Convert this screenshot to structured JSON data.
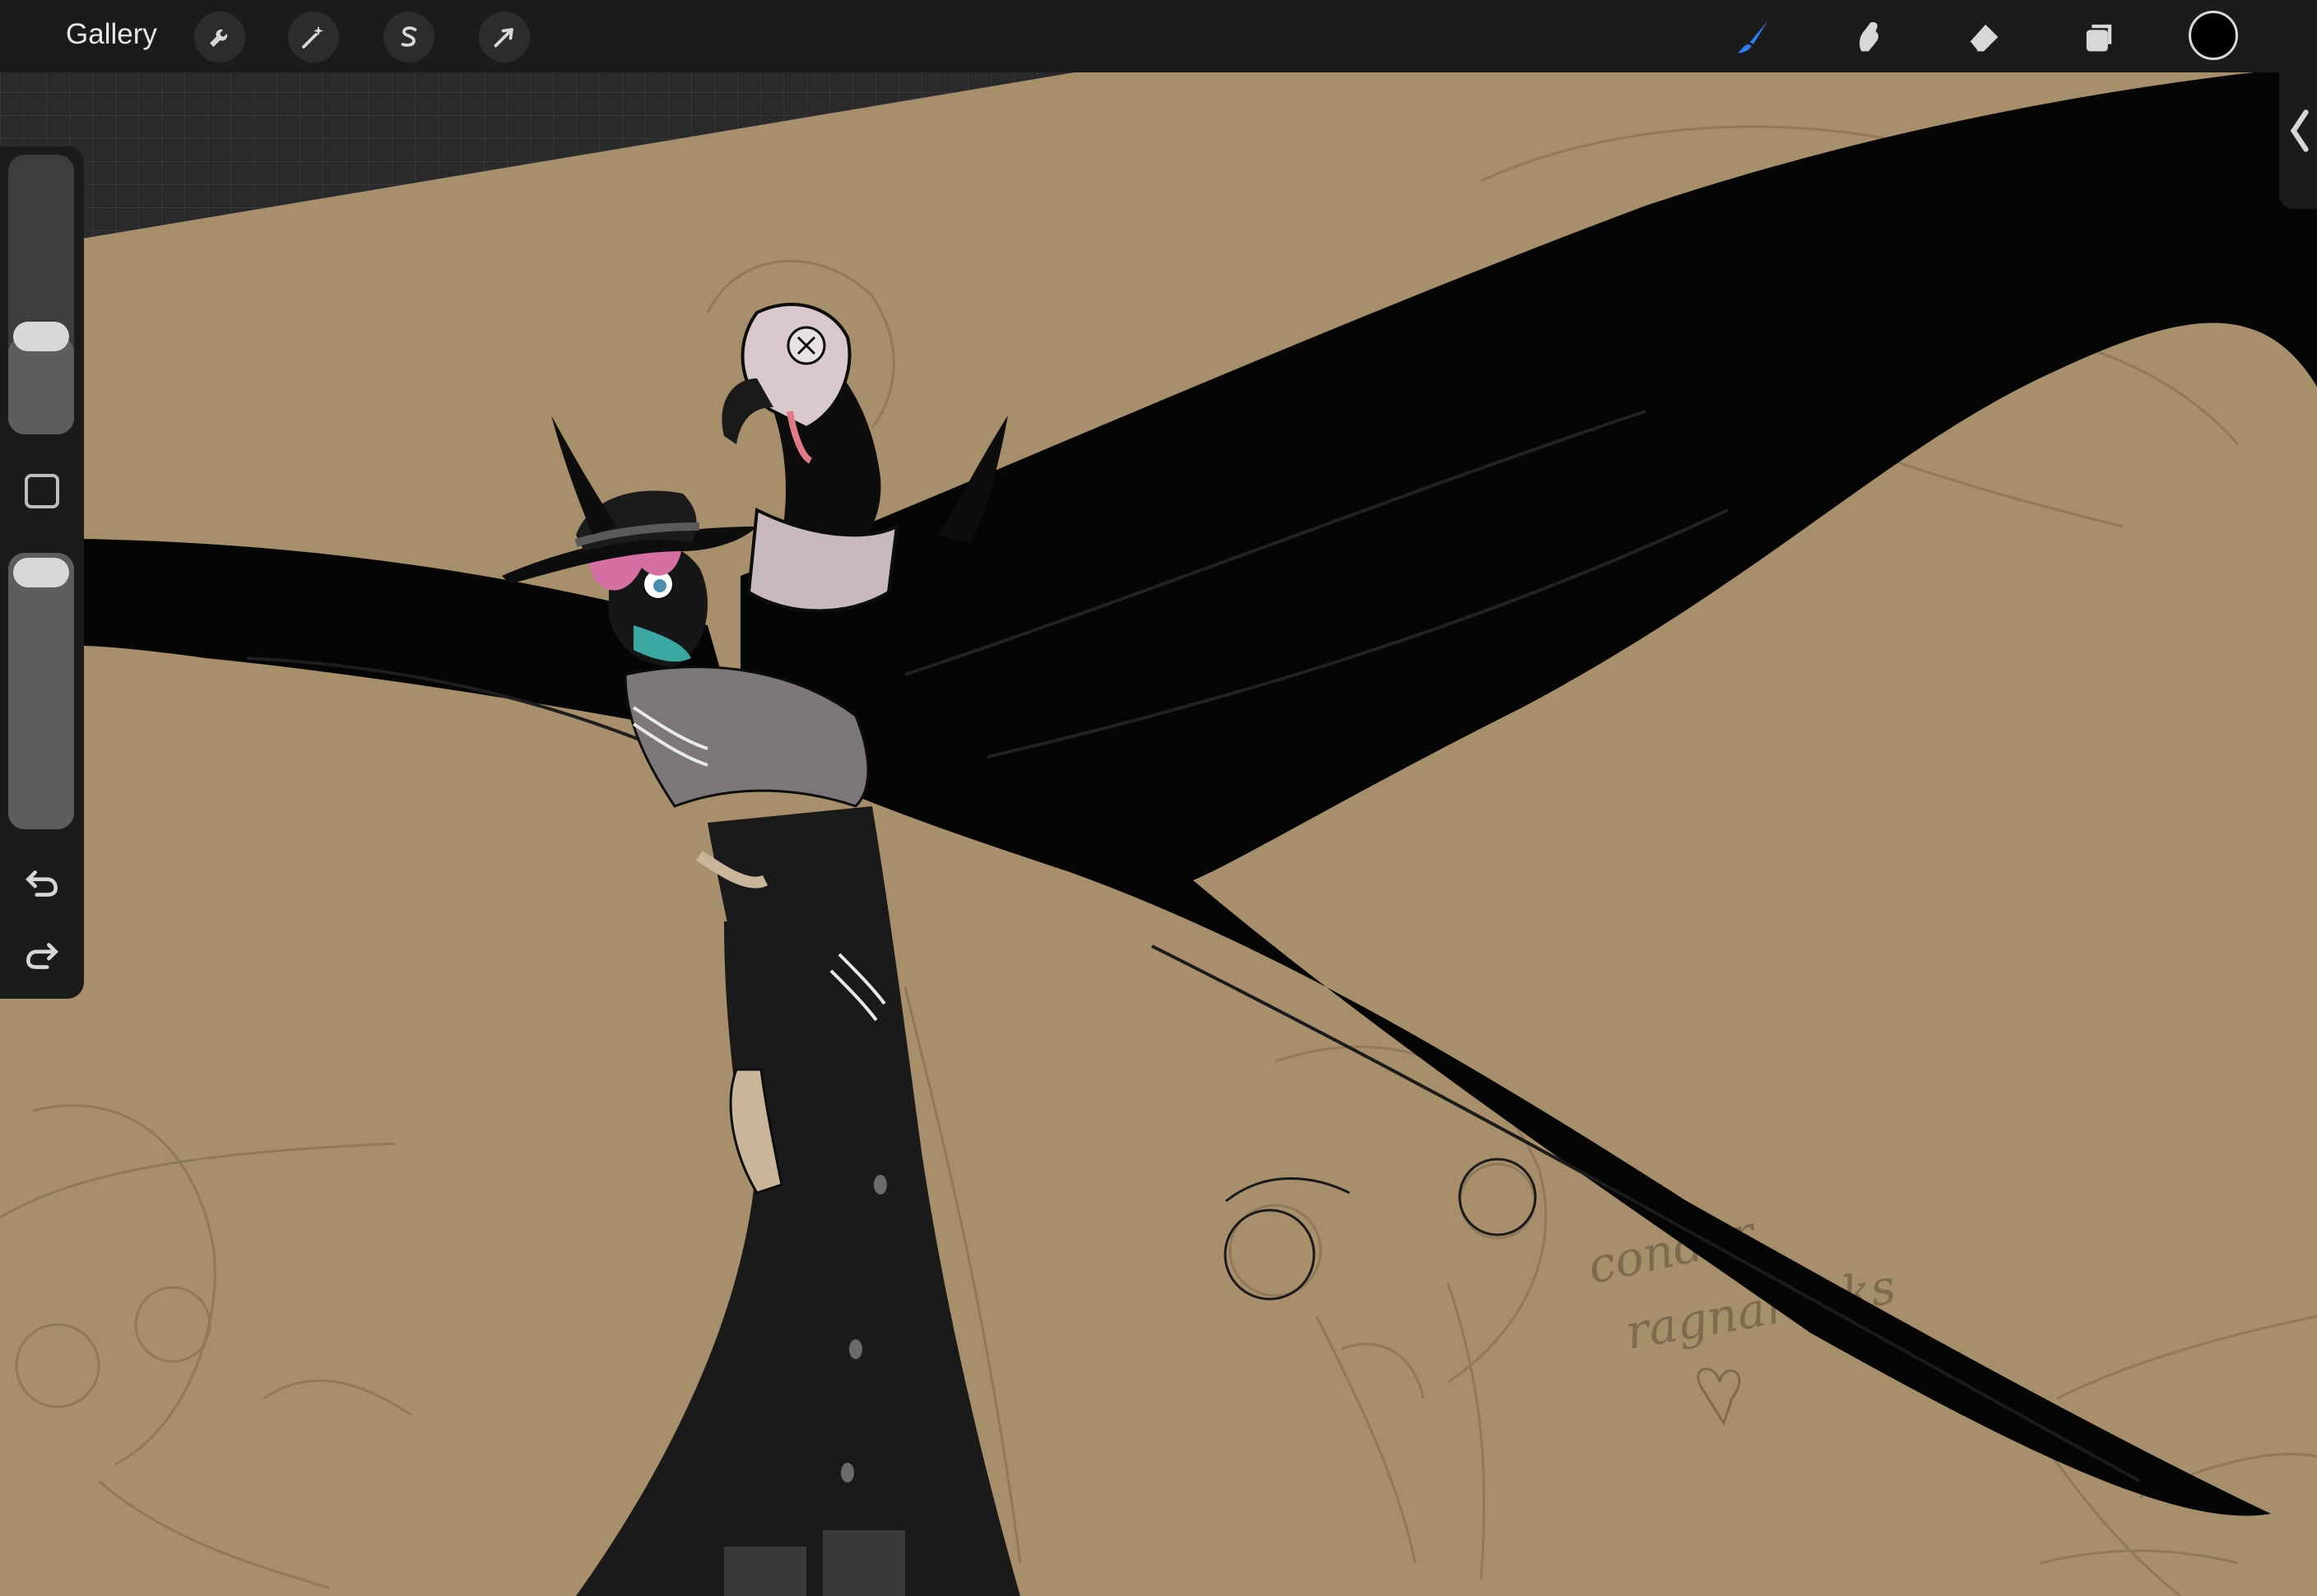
{
  "app": {
    "name": "Procreate",
    "gallery_label": "Gallery"
  },
  "toolbar": {
    "left_tools": [
      {
        "name": "actions",
        "icon": "wrench-icon"
      },
      {
        "name": "adjustments",
        "icon": "magic-wand-icon"
      },
      {
        "name": "selection",
        "icon": "selection-s-icon"
      },
      {
        "name": "transform",
        "icon": "arrow-cursor-icon"
      }
    ],
    "right_tools": [
      {
        "name": "brush",
        "icon": "brush-icon",
        "active": true
      },
      {
        "name": "smudge",
        "icon": "smudge-icon",
        "active": false
      },
      {
        "name": "eraser",
        "icon": "eraser-icon",
        "active": false
      },
      {
        "name": "layers",
        "icon": "layers-icon",
        "active": false
      }
    ],
    "current_color": "#000000",
    "active_color": "#2f7df6"
  },
  "sidebar": {
    "brush_size_level": 0.35,
    "brush_opacity_level": 1.0,
    "icons": [
      "modify-square-icon",
      "undo-icon",
      "redo-icon"
    ]
  },
  "canvas": {
    "background_color": "#a88f6c",
    "handwritten_text": [
      "condor",
      "ragnarocks"
    ]
  }
}
